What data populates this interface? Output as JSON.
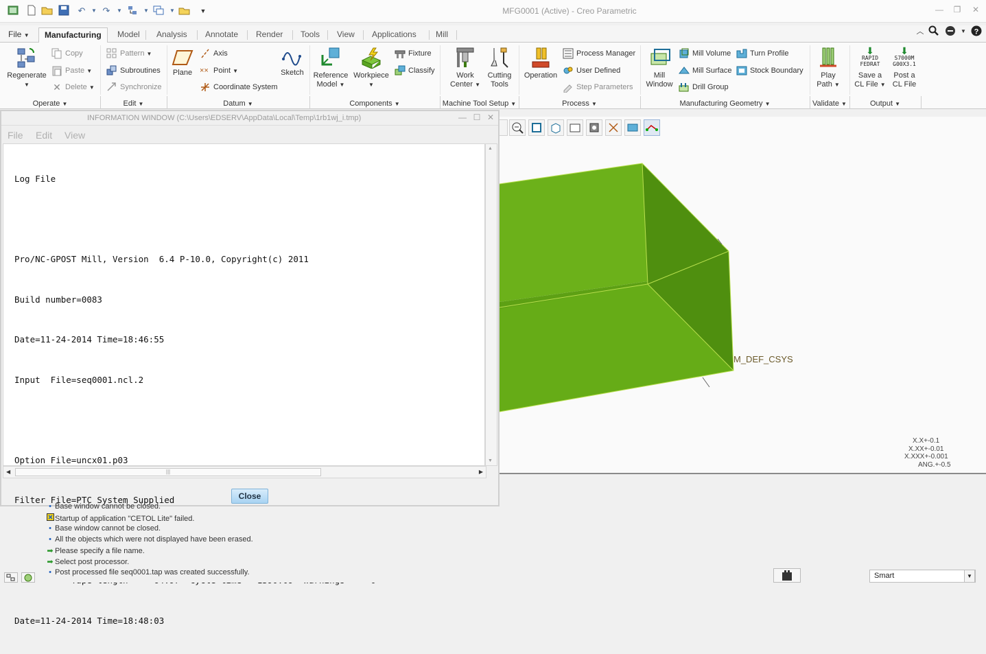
{
  "window": {
    "title": "MFG0001 (Active) - Creo Parametric",
    "controls": [
      "minimize",
      "restore",
      "close"
    ]
  },
  "tabs": {
    "file": "File",
    "items": [
      "Manufacturing",
      "Model",
      "Analysis",
      "Annotate",
      "Render",
      "Tools",
      "View",
      "Applications",
      "Mill"
    ],
    "active": "Manufacturing"
  },
  "ribbon": {
    "operate": {
      "regenerate": "Regenerate",
      "copy": "Copy",
      "paste": "Paste",
      "delete": "Delete",
      "label": "Operate"
    },
    "edit": {
      "pattern": "Pattern",
      "subroutines": "Subroutines",
      "synchronize": "Synchronize",
      "label": "Edit"
    },
    "datum": {
      "plane": "Plane",
      "axis": "Axis",
      "point": "Point",
      "coordinate_system": "Coordinate System",
      "sketch": "Sketch",
      "label": "Datum"
    },
    "components": {
      "reference_model_1": "Reference",
      "reference_model_2": "Model",
      "workpiece": "Workpiece",
      "fixture": "Fixture",
      "classify": "Classify",
      "label": "Components"
    },
    "machine": {
      "work_center_1": "Work",
      "work_center_2": "Center",
      "cutting_tools_1": "Cutting",
      "cutting_tools_2": "Tools",
      "label": "Machine Tool Setup"
    },
    "process": {
      "operation": "Operation",
      "process_manager": "Process Manager",
      "user_defined": "User Defined",
      "step_parameters": "Step Parameters",
      "label": "Process"
    },
    "geometry": {
      "mill_window_1": "Mill",
      "mill_window_2": "Window",
      "mill_volume": "Mill Volume",
      "mill_surface": "Mill Surface",
      "drill_group": "Drill Group",
      "turn_profile": "Turn Profile",
      "stock_boundary": "Stock Boundary",
      "label": "Manufacturing Geometry"
    },
    "validate": {
      "play_path_1": "Play",
      "play_path_2": "Path",
      "label": "Validate"
    },
    "output": {
      "save_cl_1": "Save a",
      "save_cl_2": "CL File",
      "post_cl_1": "Post a",
      "post_cl_2": "CL File",
      "icon_text_1a": "RAPID",
      "icon_text_1b": "FEDRAT",
      "icon_text_2a": "S7000M",
      "icon_text_2b": "G00X3.1",
      "label": "Output"
    }
  },
  "info_window": {
    "title": "INFORMATION  WINDOW (C:\\Users\\EDSERV\\AppData\\Local\\Temp\\1rb1wj_i.tmp)",
    "menu": [
      "File",
      "Edit",
      "View"
    ],
    "log_lines": [
      "Log File",
      "",
      "Pro/NC-GPOST Mill, Version  6.4 P-10.0, Copyright(c) 2011",
      "Build number=0083",
      "Date=11-24-2014 Time=18:46:55",
      "Input  File=seq0001.ncl.2",
      "",
      "Option File=uncx01.p03",
      "Filter File=PTC System Supplied",
      "",
      "       *** Tape length     64.97  Cycle time   1390.09  Warnings     0 ***",
      "Date=11-24-2014 Time=18:48:03"
    ],
    "close_button": "Close"
  },
  "graphics": {
    "csys_label": "M_DEF_CSYS",
    "part_color": "#6fb31b",
    "tolerances": [
      "X.X+-0.1",
      "X.XX+-0.01",
      "X.XXX+-0.001",
      "ANG.+-0.5"
    ]
  },
  "messages": [
    {
      "icon": "bullet",
      "text": "Base window cannot be closed."
    },
    {
      "icon": "warning",
      "text": "Startup of application \"CETOL Lite\" failed."
    },
    {
      "icon": "bullet",
      "text": "Base window cannot be closed."
    },
    {
      "icon": "bullet",
      "text": "All the objects which were not displayed have been erased."
    },
    {
      "icon": "prompt",
      "text": "Please specify a file name."
    },
    {
      "icon": "prompt",
      "text": "Select post processor."
    },
    {
      "icon": "bullet",
      "text": "Post processed file  seq0001.tap was created successfully."
    }
  ],
  "status": {
    "filter": "Smart"
  }
}
